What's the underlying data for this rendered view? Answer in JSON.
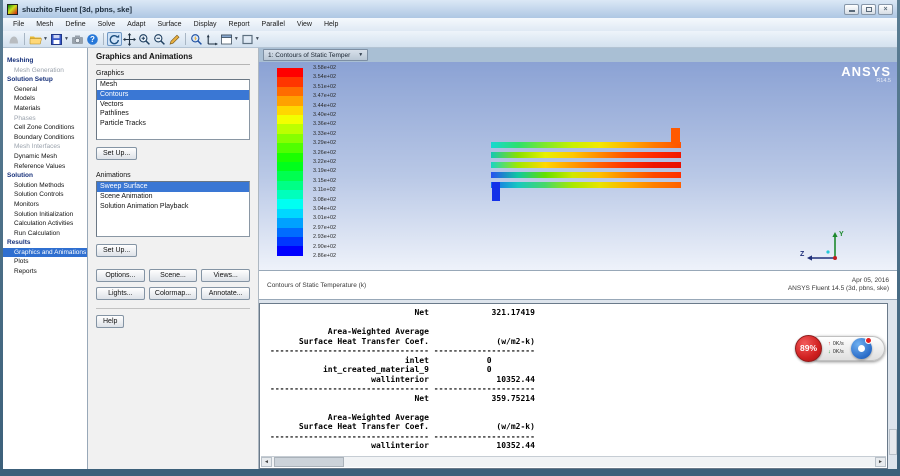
{
  "window": {
    "title": "shuzhito Fluent  [3d, pbns, ske]",
    "controls": [
      "minimize",
      "maximize",
      "close"
    ]
  },
  "menu": {
    "items": [
      "File",
      "Mesh",
      "Define",
      "Solve",
      "Adapt",
      "Surface",
      "Display",
      "Report",
      "Parallel",
      "View",
      "Help"
    ]
  },
  "toolbar": {
    "icons": [
      {
        "name": "history-icon",
        "disabled": true,
        "sep_after": true
      },
      {
        "name": "open-file-icon",
        "dropdown": true
      },
      {
        "name": "save-file-icon",
        "dropdown": true
      },
      {
        "name": "screenshot-icon"
      },
      {
        "name": "help-icon",
        "sep_after": true
      },
      {
        "name": "rotate-view-icon",
        "active": true
      },
      {
        "name": "pan-icon"
      },
      {
        "name": "zoom-in-icon"
      },
      {
        "name": "zoom-out-icon"
      },
      {
        "name": "probe-icon",
        "sep_after": true
      },
      {
        "name": "zoom-window-icon"
      },
      {
        "name": "axes-icon"
      },
      {
        "name": "panel-manager-icon",
        "dropdown": true
      },
      {
        "name": "layout-icon",
        "dropdown": true
      }
    ]
  },
  "tree": {
    "items": [
      {
        "label": "Meshing",
        "type": "header"
      },
      {
        "label": "Mesh Generation",
        "type": "item",
        "state": "disabled"
      },
      {
        "label": "Solution Setup",
        "type": "header"
      },
      {
        "label": "General",
        "type": "item"
      },
      {
        "label": "Models",
        "type": "item"
      },
      {
        "label": "Materials",
        "type": "item"
      },
      {
        "label": "Phases",
        "type": "item",
        "state": "disabled"
      },
      {
        "label": "Cell Zone Conditions",
        "type": "item"
      },
      {
        "label": "Boundary Conditions",
        "type": "item"
      },
      {
        "label": "Mesh Interfaces",
        "type": "item",
        "state": "disabled"
      },
      {
        "label": "Dynamic Mesh",
        "type": "item"
      },
      {
        "label": "Reference Values",
        "type": "item"
      },
      {
        "label": "Solution",
        "type": "header"
      },
      {
        "label": "Solution Methods",
        "type": "item"
      },
      {
        "label": "Solution Controls",
        "type": "item"
      },
      {
        "label": "Monitors",
        "type": "item"
      },
      {
        "label": "Solution Initialization",
        "type": "item"
      },
      {
        "label": "Calculation Activities",
        "type": "item"
      },
      {
        "label": "Run Calculation",
        "type": "item"
      },
      {
        "label": "Results",
        "type": "header"
      },
      {
        "label": "Graphics and Animations",
        "type": "item",
        "state": "selected"
      },
      {
        "label": "Plots",
        "type": "item"
      },
      {
        "label": "Reports",
        "type": "item"
      }
    ]
  },
  "panel": {
    "title": "Graphics and Animations",
    "graphics_label": "Graphics",
    "graphics_items": [
      {
        "label": "Mesh"
      },
      {
        "label": "Contours",
        "selected": true
      },
      {
        "label": "Vectors"
      },
      {
        "label": "Pathlines"
      },
      {
        "label": "Particle Tracks"
      }
    ],
    "setup_label": "Set Up...",
    "animations_label": "Animations",
    "animations_items": [
      {
        "label": "Sweep Surface",
        "selected": true
      },
      {
        "label": "Scene Animation"
      },
      {
        "label": "Solution Animation Playback"
      }
    ],
    "buttons_row1": [
      "Options...",
      "Scene...",
      "Views..."
    ],
    "buttons_row2": [
      "Lights...",
      "Colormap...",
      "Annotate..."
    ],
    "help_label": "Help"
  },
  "graphics": {
    "view_selector": "1: Contours of Static Temper",
    "logo": "ANSYS",
    "logo_version": "R14.5",
    "caption": "Contours of Static Temperature (k)",
    "date": "Apr 05, 2016",
    "app_version": "ANSYS Fluent 14.5 (3d, pbns, ske)",
    "axis_labels": {
      "y": "Y",
      "z": "Z"
    },
    "colorbar": {
      "labels": [
        "3.58e+02",
        "3.54e+02",
        "3.51e+02",
        "3.47e+02",
        "3.44e+02",
        "3.40e+02",
        "3.36e+02",
        "3.33e+02",
        "3.29e+02",
        "3.26e+02",
        "3.22e+02",
        "3.19e+02",
        "3.15e+02",
        "3.11e+02",
        "3.08e+02",
        "3.04e+02",
        "3.01e+02",
        "2.97e+02",
        "2.93e+02",
        "2.90e+02",
        "2.86e+02"
      ],
      "band_colors": [
        "#ff0000",
        "#ff3600",
        "#ff6c00",
        "#ffa100",
        "#ffd700",
        "#f2ff00",
        "#bcff00",
        "#86ff00",
        "#50ff00",
        "#1bff00",
        "#00ff1b",
        "#00ff50",
        "#00ff86",
        "#00ffbc",
        "#00fff2",
        "#00d7ff",
        "#00a1ff",
        "#006cff",
        "#0036ff",
        "#0000ff"
      ]
    },
    "contour": {
      "rows": [
        [
          "#19d8d2",
          "#2ee06e",
          "#7fe82a",
          "#c8f000",
          "#f4e800",
          "#ffb400",
          "#ff7a00",
          "#ff5200"
        ],
        [
          "#16c8b4",
          "#8ae000",
          "#e8f000",
          "#ffc800",
          "#ff8a00",
          "#ff4e00",
          "#ff2a00",
          "#f01800"
        ],
        [
          "#1ad4c4",
          "#a0e800",
          "#ffd800",
          "#ff9c00",
          "#ff6000",
          "#ff3000",
          "#ee1600",
          "#e81000"
        ],
        [
          "#2a50f0",
          "#12c8a0",
          "#64e000",
          "#d0e800",
          "#ffc000",
          "#ff8000",
          "#ff4800",
          "#ff3000"
        ],
        [
          "#1868f0",
          "#18c8c0",
          "#48d868",
          "#a8e800",
          "#e8e400",
          "#ffb000",
          "#ff8000",
          "#ff6000"
        ]
      ],
      "stub_top_color": "#ff5a00",
      "stub_bottom_color": "#1430e8"
    }
  },
  "console": {
    "lines": [
      "                              Net             321.17419",
      "",
      "            Area-Weighted Average",
      "      Surface Heat Transfer Coef.              (w/m2-k)",
      "--------------------------------- ---------------------",
      "                            inlet            0",
      "           int_created_material_9            0",
      "                     wallinterior              10352.44",
      "--------------------------------- ---------------------",
      "                              Net             359.75214",
      "",
      "            Area-Weighted Average",
      "      Surface Heat Transfer Coef.              (w/m2-k)",
      "--------------------------------- ---------------------",
      "                     wallinterior              10352.44"
    ]
  },
  "overlay_widget": {
    "percent": "89%",
    "up_speed": "0K/s",
    "down_speed": "0K/s"
  }
}
